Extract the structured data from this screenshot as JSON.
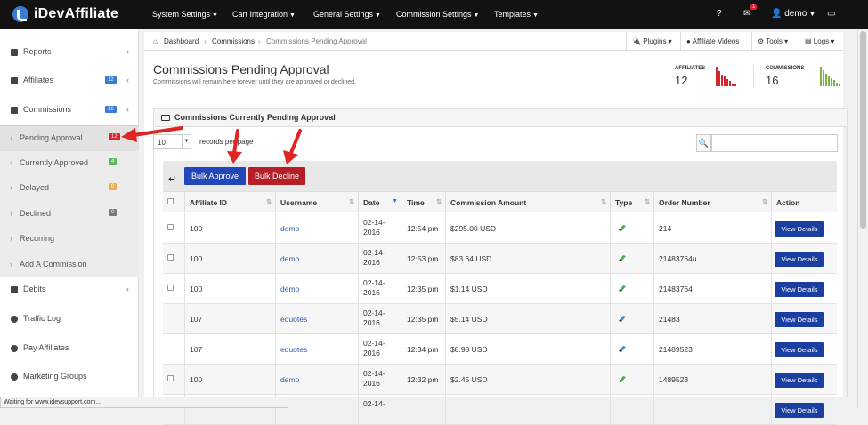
{
  "app": {
    "name": "iDevAffiliate"
  },
  "topnav": {
    "items": [
      "System Settings",
      "Cart Integration",
      "General Settings",
      "Commission Settings",
      "Templates"
    ],
    "notification_count": "1",
    "user": "demo"
  },
  "sidebar": {
    "reports": "Reports",
    "affiliates": {
      "label": "Affiliates",
      "count": "12"
    },
    "commissions": {
      "label": "Commissions",
      "count": "16"
    },
    "sub": [
      {
        "label": "Pending Approval",
        "count": "12",
        "color": "#d9232d"
      },
      {
        "label": "Currently Approved",
        "count": "4",
        "color": "#5cb85c"
      },
      {
        "label": "Delayed",
        "count": "0",
        "color": "#f0ad4e"
      },
      {
        "label": "Declined",
        "count": "0",
        "color": "#777777"
      },
      {
        "label": "Recurring",
        "count": "",
        "color": ""
      },
      {
        "label": "Add A Commission",
        "count": "",
        "color": ""
      }
    ],
    "debits": "Debits",
    "traffic_log": "Traffic Log",
    "pay_affiliates": "Pay Affiliates",
    "marketing_groups": "Marketing Groups"
  },
  "breadcrumb": {
    "home": "Dashboard",
    "section": "Commissions",
    "current": "Commissions Pending Approval"
  },
  "toolbar": {
    "plugins": "Plugins",
    "videos": "Affiliate Videos",
    "tools": "Tools",
    "logs": "Logs"
  },
  "page": {
    "title": "Commissions Pending Approval",
    "subtitle": "Commissions will remain here forever until they are approved or declined."
  },
  "stats": [
    {
      "label": "AFFILIATES",
      "value": "12",
      "color": "#d9232d",
      "bars": [
        1.0,
        0.75,
        0.6,
        0.5,
        0.35,
        0.25,
        0.15,
        0.1
      ]
    },
    {
      "label": "COMMISSIONS",
      "value": "16",
      "color": "#7cb342",
      "bars": [
        1.0,
        0.8,
        0.65,
        0.5,
        0.4,
        0.3,
        0.2,
        0.12
      ]
    }
  ],
  "panel": {
    "title": "Commissions Currently Pending Approval"
  },
  "table_controls": {
    "page_size": "10",
    "records_label": "records per page"
  },
  "bulk": {
    "approve": "Bulk Approve",
    "decline": "Bulk Decline"
  },
  "columns": [
    "Affiliate ID",
    "Username",
    "Date",
    "Time",
    "Commission Amount",
    "Type",
    "Order Number",
    "Action"
  ],
  "rows": [
    {
      "checkbox": true,
      "affiliate_id": "100",
      "username": "demo",
      "date": "02-14-2016",
      "time": "12:54 pm",
      "amount": "$295.00 USD",
      "type_color": "#4caf50",
      "order": "214",
      "action": "View Details"
    },
    {
      "checkbox": true,
      "affiliate_id": "100",
      "username": "demo",
      "date": "02-14-2016",
      "time": "12:53 pm",
      "amount": "$83.64 USD",
      "type_color": "#4caf50",
      "order": "21483764u",
      "action": "View Details"
    },
    {
      "checkbox": true,
      "affiliate_id": "100",
      "username": "demo",
      "date": "02-14-2016",
      "time": "12:35 pm",
      "amount": "$1.14 USD",
      "type_color": "#4caf50",
      "order": "21483764",
      "action": "View Details"
    },
    {
      "checkbox": false,
      "affiliate_id": "107",
      "username": "equotes",
      "date": "02-14-2016",
      "time": "12:35 pm",
      "amount": "$5.14 USD",
      "type_color": "#3a8ad8",
      "order": "21483",
      "action": "View Details"
    },
    {
      "checkbox": false,
      "affiliate_id": "107",
      "username": "equotes",
      "date": "02-14-2016",
      "time": "12:34 pm",
      "amount": "$8.98 USD",
      "type_color": "#3a8ad8",
      "order": "21489523",
      "action": "View Details"
    },
    {
      "checkbox": true,
      "affiliate_id": "100",
      "username": "demo",
      "date": "02-14-2016",
      "time": "12:32 pm",
      "amount": "$2.45 USD",
      "type_color": "#4caf50",
      "order": "1489523",
      "action": "View Details"
    },
    {
      "checkbox": false,
      "affiliate_id": "",
      "username": "",
      "date": "02-14-",
      "time": "",
      "amount": "",
      "type_color": "",
      "order": "",
      "action": "View Details"
    }
  ],
  "statusbar": "Waiting for www.idevsupport.com...",
  "colors": {
    "approve": "#2346b8",
    "decline": "#b51f25",
    "annotation_arrow": "#e02424"
  }
}
